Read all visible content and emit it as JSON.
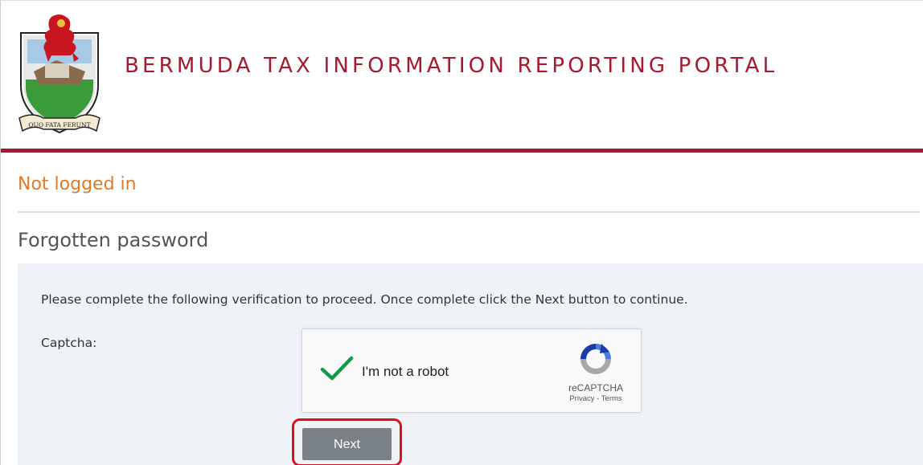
{
  "header": {
    "title": "BERMUDA TAX INFORMATION REPORTING PORTAL",
    "crest_motto": "QUO FATA FERUNT",
    "crest_icon": "bermuda-coat-of-arms-icon",
    "accent_color": "#a6192e"
  },
  "status": {
    "text": "Not logged in",
    "color": "#e07a26"
  },
  "page": {
    "heading": "Forgotten password"
  },
  "form": {
    "instructions": "Please complete the following verification to proceed. Once complete click the Next button to continue.",
    "captcha_label": "Captcha:",
    "recaptcha": {
      "checked": true,
      "label": "I'm not a robot",
      "brand": "reCAPTCHA",
      "privacy": "Privacy",
      "separator": " - ",
      "terms": "Terms",
      "check_icon": "green-checkmark-icon",
      "logo_icon": "recaptcha-logo-icon"
    },
    "next_button": "Next"
  }
}
